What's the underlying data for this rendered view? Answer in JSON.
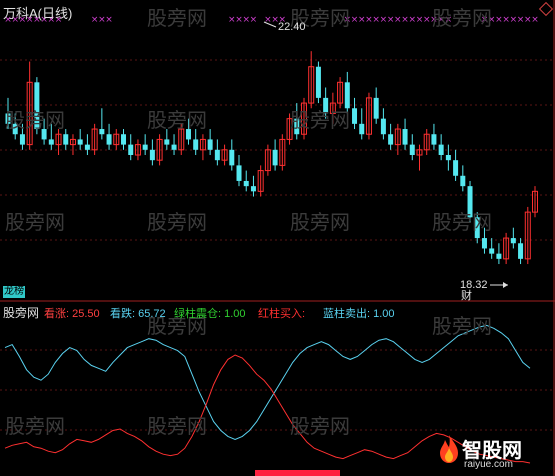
{
  "title": "万科A(日线)",
  "watermark": "股旁网",
  "peak_label": "22.40",
  "trough_label": "18.32",
  "badge_top": "龙榜",
  "badge_bottom": "财",
  "indicator": {
    "name": "股旁网",
    "items": [
      {
        "label": "看涨:",
        "value": "25.50",
        "color": "#ff4040"
      },
      {
        "label": "看跌:",
        "value": "65.72",
        "color": "#5ad2f0"
      },
      {
        "label": "绿柱震仓:",
        "value": "1.00",
        "color": "#30d030"
      },
      {
        "label": "红柱买入:",
        "value": "",
        "color": "#ff3030"
      },
      {
        "label": "蓝柱卖出:",
        "value": "1.00",
        "color": "#5ad2f0"
      }
    ]
  },
  "logo": {
    "text": "智股网",
    "sub": "raiyue.com"
  },
  "colors": {
    "up": "#ff3030",
    "down": "#55e8f0",
    "bull": "#ff3030",
    "bear": "#5ad2f0",
    "mark": "#d040d0"
  },
  "chart_data": {
    "type": "candlestick",
    "price_range": [
      17.8,
      23.0
    ],
    "candles": [
      [
        21.2,
        21.5,
        20.9,
        21.0
      ],
      [
        21.0,
        21.2,
        20.7,
        20.8
      ],
      [
        20.8,
        21.0,
        20.5,
        20.6
      ],
      [
        20.6,
        22.2,
        20.5,
        21.8
      ],
      [
        21.8,
        21.9,
        20.8,
        20.9
      ],
      [
        20.9,
        21.1,
        20.6,
        20.7
      ],
      [
        20.7,
        21.0,
        20.5,
        20.6
      ],
      [
        20.6,
        20.9,
        20.4,
        20.8
      ],
      [
        20.8,
        20.9,
        20.5,
        20.6
      ],
      [
        20.6,
        20.8,
        20.4,
        20.7
      ],
      [
        20.7,
        20.9,
        20.5,
        20.6
      ],
      [
        20.6,
        20.8,
        20.4,
        20.5
      ],
      [
        20.5,
        21.0,
        20.4,
        20.9
      ],
      [
        20.9,
        21.3,
        20.7,
        20.8
      ],
      [
        20.8,
        21.0,
        20.5,
        20.6
      ],
      [
        20.6,
        20.9,
        20.5,
        20.8
      ],
      [
        20.8,
        20.9,
        20.5,
        20.6
      ],
      [
        20.6,
        20.8,
        20.3,
        20.4
      ],
      [
        20.4,
        20.7,
        20.3,
        20.6
      ],
      [
        20.6,
        20.8,
        20.4,
        20.5
      ],
      [
        20.5,
        20.7,
        20.2,
        20.3
      ],
      [
        20.3,
        20.8,
        20.2,
        20.7
      ],
      [
        20.7,
        20.9,
        20.5,
        20.6
      ],
      [
        20.6,
        20.8,
        20.4,
        20.5
      ],
      [
        20.5,
        21.0,
        20.4,
        20.9
      ],
      [
        20.9,
        21.1,
        20.6,
        20.7
      ],
      [
        20.7,
        20.9,
        20.4,
        20.5
      ],
      [
        20.5,
        20.8,
        20.3,
        20.7
      ],
      [
        20.7,
        20.9,
        20.4,
        20.5
      ],
      [
        20.5,
        20.7,
        20.2,
        20.3
      ],
      [
        20.3,
        20.6,
        20.2,
        20.5
      ],
      [
        20.5,
        20.7,
        20.1,
        20.2
      ],
      [
        20.2,
        20.4,
        19.8,
        19.9
      ],
      [
        19.9,
        20.1,
        19.7,
        19.8
      ],
      [
        19.8,
        20.0,
        19.6,
        19.7
      ],
      [
        19.7,
        20.2,
        19.6,
        20.1
      ],
      [
        20.1,
        20.6,
        20.0,
        20.5
      ],
      [
        20.5,
        20.7,
        20.1,
        20.2
      ],
      [
        20.2,
        20.8,
        20.1,
        20.7
      ],
      [
        20.7,
        21.2,
        20.6,
        21.1
      ],
      [
        21.1,
        21.4,
        20.7,
        20.8
      ],
      [
        20.8,
        21.5,
        20.7,
        21.4
      ],
      [
        21.4,
        22.4,
        21.3,
        22.1
      ],
      [
        22.1,
        22.2,
        21.4,
        21.5
      ],
      [
        21.5,
        21.7,
        21.1,
        21.2
      ],
      [
        21.2,
        21.6,
        21.0,
        21.4
      ],
      [
        21.4,
        21.9,
        21.3,
        21.8
      ],
      [
        21.8,
        22.0,
        21.2,
        21.3
      ],
      [
        21.3,
        21.5,
        20.9,
        21.0
      ],
      [
        21.0,
        21.3,
        20.7,
        20.8
      ],
      [
        20.8,
        21.6,
        20.7,
        21.5
      ],
      [
        21.5,
        21.7,
        21.0,
        21.1
      ],
      [
        21.1,
        21.3,
        20.7,
        20.8
      ],
      [
        20.8,
        21.0,
        20.5,
        20.6
      ],
      [
        20.6,
        21.0,
        20.4,
        20.9
      ],
      [
        20.9,
        21.1,
        20.5,
        20.6
      ],
      [
        20.6,
        20.8,
        20.3,
        20.4
      ],
      [
        20.4,
        20.6,
        20.1,
        20.5
      ],
      [
        20.5,
        20.9,
        20.4,
        20.8
      ],
      [
        20.8,
        21.0,
        20.5,
        20.6
      ],
      [
        20.6,
        20.8,
        20.3,
        20.4
      ],
      [
        20.4,
        20.6,
        20.1,
        20.3
      ],
      [
        20.3,
        20.5,
        19.9,
        20.0
      ],
      [
        20.0,
        20.2,
        19.7,
        19.8
      ],
      [
        19.8,
        19.9,
        19.1,
        19.2
      ],
      [
        19.2,
        19.3,
        18.7,
        18.8
      ],
      [
        18.8,
        19.0,
        18.5,
        18.6
      ],
      [
        18.6,
        18.8,
        18.4,
        18.5
      ],
      [
        18.5,
        18.7,
        18.3,
        18.4
      ],
      [
        18.4,
        18.9,
        18.3,
        18.8
      ],
      [
        18.8,
        19.0,
        18.6,
        18.7
      ],
      [
        18.7,
        18.8,
        18.3,
        18.4
      ],
      [
        18.4,
        19.4,
        18.3,
        19.3
      ],
      [
        19.3,
        19.8,
        19.2,
        19.7
      ]
    ],
    "mark_positions": [
      0,
      1,
      2,
      3,
      4,
      5,
      6,
      7,
      12,
      13,
      14,
      31,
      32,
      33,
      34,
      36,
      37,
      38,
      47,
      48,
      49,
      50,
      51,
      52,
      53,
      54,
      55,
      56,
      57,
      58,
      59,
      60,
      61,
      66,
      67,
      68,
      69,
      70,
      71,
      72,
      73
    ],
    "oscillator_range": [
      0,
      100
    ],
    "bull": [
      12,
      14,
      15,
      16,
      13,
      12,
      10,
      9,
      11,
      15,
      18,
      17,
      16,
      18,
      21,
      24,
      25,
      22,
      20,
      17,
      13,
      10,
      8,
      7,
      8,
      12,
      20,
      30,
      42,
      55,
      65,
      72,
      75,
      73,
      68,
      62,
      58,
      52,
      44,
      36,
      28,
      22,
      16,
      12,
      10,
      8,
      6,
      5,
      7,
      9,
      11,
      10,
      8,
      6,
      5,
      7,
      9,
      13,
      17,
      20,
      22,
      21,
      19,
      16,
      13,
      10,
      8,
      7,
      6,
      5,
      4,
      3,
      3,
      2
    ],
    "bear": [
      80,
      82,
      74,
      65,
      60,
      58,
      62,
      70,
      76,
      80,
      78,
      72,
      68,
      66,
      64,
      70,
      75,
      80,
      82,
      84,
      86,
      85,
      82,
      80,
      78,
      74,
      62,
      50,
      40,
      30,
      24,
      20,
      18,
      20,
      24,
      30,
      38,
      46,
      54,
      62,
      70,
      76,
      80,
      82,
      84,
      82,
      78,
      74,
      72,
      74,
      78,
      82,
      85,
      86,
      84,
      80,
      76,
      72,
      70,
      72,
      76,
      80,
      84,
      88,
      90,
      92,
      94,
      95,
      93,
      90,
      86,
      78,
      70,
      66
    ]
  }
}
